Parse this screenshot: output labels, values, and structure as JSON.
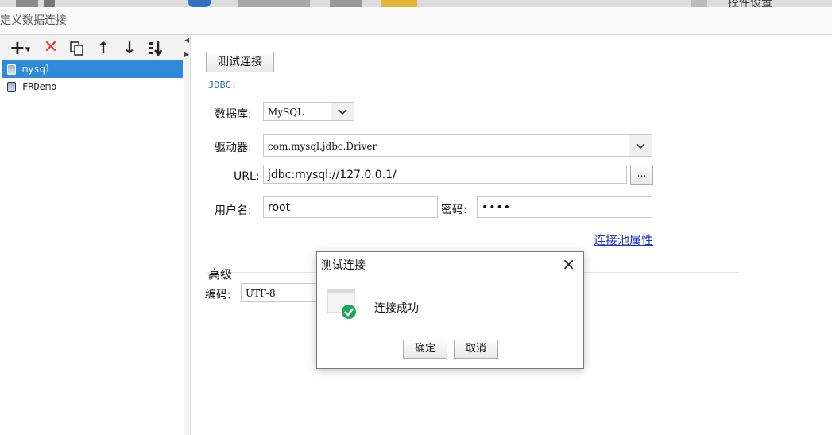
{
  "app": {
    "top_right_label": "控件设置",
    "window_title": "定义数据连接"
  },
  "left": {
    "toolbar": {
      "add_icon": "plus-icon",
      "delete_icon": "delete-x-icon",
      "copy_icon": "copy-icon",
      "up_icon": "arrow-up-icon",
      "down_icon": "arrow-down-icon",
      "sort_icon": "sort-icon"
    },
    "connections": [
      {
        "name": "mysql",
        "selected": true
      },
      {
        "name": "FRDemo",
        "selected": false
      }
    ]
  },
  "form": {
    "test_button": "测试连接",
    "group_title": "JDBC:",
    "database_label": "数据库:",
    "database_value": "MySQL",
    "driver_label": "驱动器:",
    "driver_value": "com.mysql.jdbc.Driver",
    "url_label": "URL:",
    "url_value": "jdbc:mysql://127.0.0.1/",
    "url_browse": "...",
    "username_label": "用户名:",
    "username_value": "root",
    "password_label": "密码:",
    "password_value": "••••",
    "pool_link": "连接池属性",
    "advanced_label": "高级",
    "encoding_label": "编码:",
    "encoding_value": "UTF-8"
  },
  "dialog": {
    "title": "测试连接",
    "close": "×",
    "message": "连接成功",
    "ok": "确定",
    "cancel": "取消",
    "success_color": "#1fa55a"
  }
}
